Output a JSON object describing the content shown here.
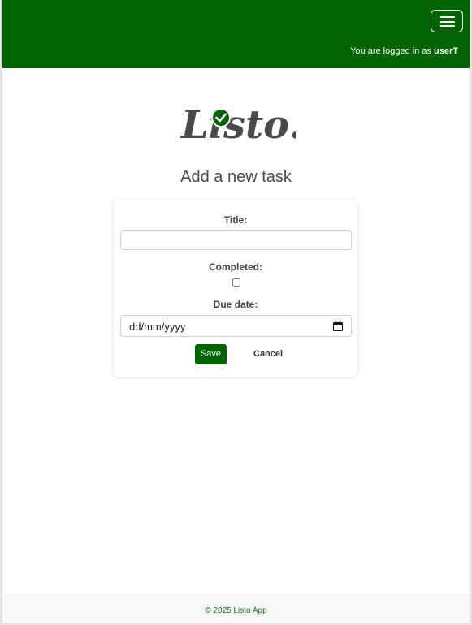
{
  "navbar": {
    "login_prefix": "You are logged in as ",
    "username": "userT",
    "brand_color": "#006400"
  },
  "logo": {
    "text": "Listo!",
    "check_color": "#006400",
    "icon": "check-circle-icon"
  },
  "page": {
    "title": "Add a new task"
  },
  "form": {
    "title_label": "Title:",
    "title_value": "",
    "completed_label": "Completed:",
    "completed_checked": false,
    "due_date_label": "Due date:",
    "due_date_placeholder": "dd/mm/yyyy",
    "save_label": "Save",
    "cancel_label": "Cancel"
  },
  "footer": {
    "text": "© 2025 Listo App"
  }
}
